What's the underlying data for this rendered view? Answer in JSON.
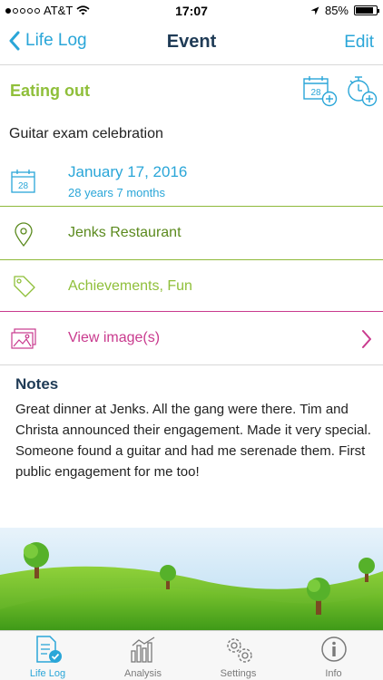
{
  "status_bar": {
    "carrier": "AT&T",
    "time": "17:07",
    "battery": "85%",
    "battery_level": 0.85
  },
  "nav": {
    "back_label": "Life Log",
    "title": "Event",
    "edit_label": "Edit"
  },
  "category": {
    "title": "Eating out",
    "calendar_day": "28"
  },
  "event": {
    "title": "Guitar exam celebration"
  },
  "date": {
    "main": "January 17, 2016",
    "sub": "28 years 7 months",
    "icon_day": "28"
  },
  "location": {
    "name": "Jenks Restaurant"
  },
  "tags": {
    "text": "Achievements, Fun"
  },
  "images": {
    "label": "View image(s)"
  },
  "notes": {
    "heading": "Notes",
    "body": "Great dinner at Jenks. All the gang were there. Tim and Christa announced their engagement. Made it very special. Someone found  a guitar and had me serenade them. First public engagement for me too!"
  },
  "tabs": [
    {
      "label": "Life Log",
      "icon": "document-check-icon",
      "active": true
    },
    {
      "label": "Analysis",
      "icon": "bar-chart-icon",
      "active": false
    },
    {
      "label": "Settings",
      "icon": "gears-icon",
      "active": false
    },
    {
      "label": "Info",
      "icon": "info-icon",
      "active": false
    }
  ],
  "colors": {
    "accent_blue": "#2aa6d8",
    "navy": "#1f3b56",
    "green": "#8fbf3a",
    "location_green": "#5b8a1e",
    "magenta": "#c93a8e"
  }
}
